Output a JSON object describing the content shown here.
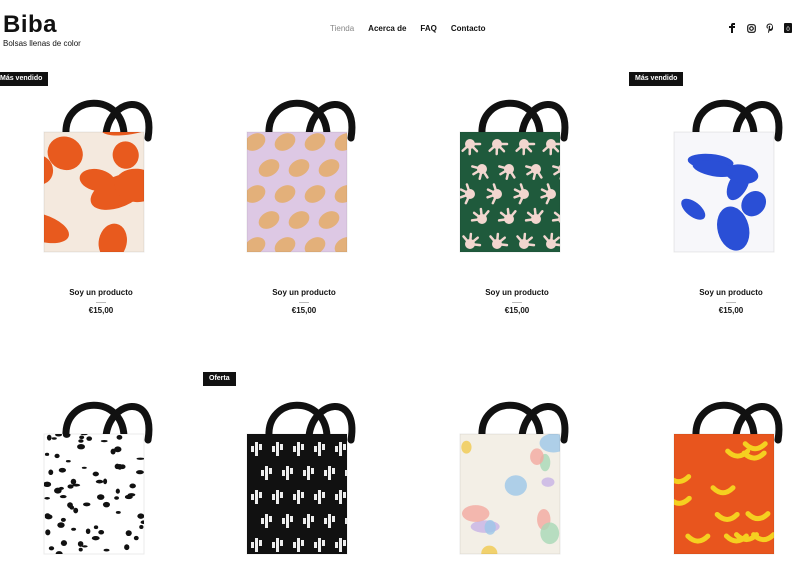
{
  "brand": {
    "name": "Biba",
    "tagline": "Bolsas llenas de color"
  },
  "nav": {
    "items": [
      {
        "label": "Tienda",
        "active": true
      },
      {
        "label": "Acerca de",
        "active": false
      },
      {
        "label": "FAQ",
        "active": false
      },
      {
        "label": "Contacto",
        "active": false
      }
    ]
  },
  "social": {
    "icons": [
      "facebook-icon",
      "instagram-icon",
      "pinterest-icon",
      "cart-icon"
    ],
    "cart_count": "0"
  },
  "products": [
    {
      "name": "Soy un producto",
      "price": "€15,00",
      "badge": "Más vendido",
      "pattern": "orange-abstract",
      "color": "#e85a1e"
    },
    {
      "name": "Soy un producto",
      "price": "€15,00",
      "badge": "",
      "pattern": "lemons",
      "color": "#e3b07a"
    },
    {
      "name": "Soy un producto",
      "price": "€15,00",
      "badge": "",
      "pattern": "green-hands",
      "color": "#1f5a3c"
    },
    {
      "name": "Soy un producto",
      "price": "€15,00",
      "badge": "Más vendido",
      "pattern": "blue-blobs",
      "color": "#2a4fd6"
    },
    {
      "name": "",
      "price": "",
      "badge": "",
      "pattern": "black-dots",
      "color": "#ffffff"
    },
    {
      "name": "",
      "price": "",
      "badge": "Oferta",
      "pattern": "cactus",
      "color": "#111111"
    },
    {
      "name": "",
      "price": "",
      "badge": "",
      "pattern": "pastel-doodles",
      "color": "#f3efe6"
    },
    {
      "name": "",
      "price": "",
      "badge": "",
      "pattern": "bananas",
      "color": "#e8551e"
    }
  ]
}
